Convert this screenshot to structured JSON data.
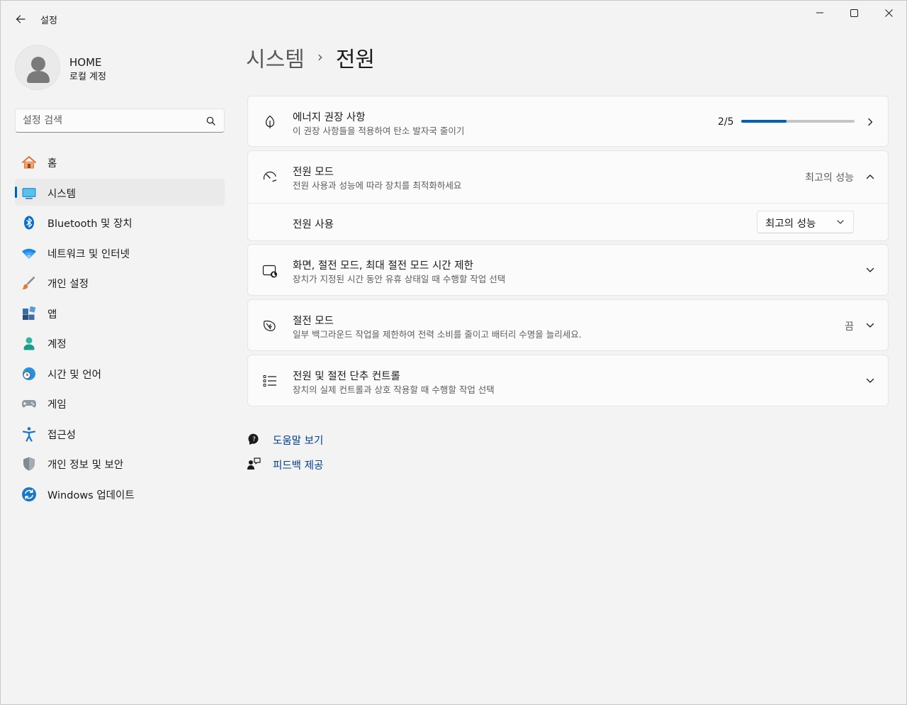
{
  "window": {
    "title": "설정"
  },
  "profile": {
    "name": "HOME",
    "account_type": "로컬 계정"
  },
  "search": {
    "placeholder": "설정 검색"
  },
  "nav": {
    "items": [
      {
        "label": "홈",
        "icon": "home-icon"
      },
      {
        "label": "시스템",
        "icon": "system-icon",
        "active": true
      },
      {
        "label": "Bluetooth 및 장치",
        "icon": "bluetooth-icon"
      },
      {
        "label": "네트워크 및 인터넷",
        "icon": "wifi-icon"
      },
      {
        "label": "개인 설정",
        "icon": "brush-icon"
      },
      {
        "label": "앱",
        "icon": "apps-icon"
      },
      {
        "label": "계정",
        "icon": "account-icon"
      },
      {
        "label": "시간 및 언어",
        "icon": "time-language-icon"
      },
      {
        "label": "게임",
        "icon": "gamepad-icon"
      },
      {
        "label": "접근성",
        "icon": "accessibility-icon"
      },
      {
        "label": "개인 정보 및 보안",
        "icon": "shield-icon"
      },
      {
        "label": "Windows 업데이트",
        "icon": "update-icon"
      }
    ]
  },
  "breadcrumb": {
    "parent": "시스템",
    "separator": "›",
    "current": "전원"
  },
  "cards": {
    "energy": {
      "title": "에너지 권장 사항",
      "desc": "이 권장 사항들을 적용하여 탄소 발자국 줄이기",
      "progress_text": "2/5",
      "progress_fraction": 0.4
    },
    "power_mode": {
      "title": "전원 모드",
      "desc": "전원 사용과 성능에 따라 장치를 최적화하세요",
      "value": "최고의 성능",
      "sub_label": "전원 사용",
      "dropdown_value": "최고의 성능"
    },
    "screen_sleep": {
      "title": "화면, 절전 모드, 최대 절전 모드 시간 제한",
      "desc": "장치가 지정된 시간 동안 유휴 상태일 때 수행할 작업 선택"
    },
    "energy_saver": {
      "title": "절전 모드",
      "desc": "일부 백그라운드 작업을 제한하여 전력 소비를 줄이고 배터리 수명을 늘리세요.",
      "value": "끔"
    },
    "power_controls": {
      "title": "전원 및 절전 단추 컨트롤",
      "desc": "장치의 실제 컨트롤과 상호 작용할 때 수행할 작업 선택"
    }
  },
  "links": {
    "help": "도움말 보기",
    "feedback": "피드백 제공"
  },
  "colors": {
    "accent": "#005fb8",
    "background": "#f3f3f3",
    "card": "#fbfbfb",
    "link": "#003e92"
  }
}
